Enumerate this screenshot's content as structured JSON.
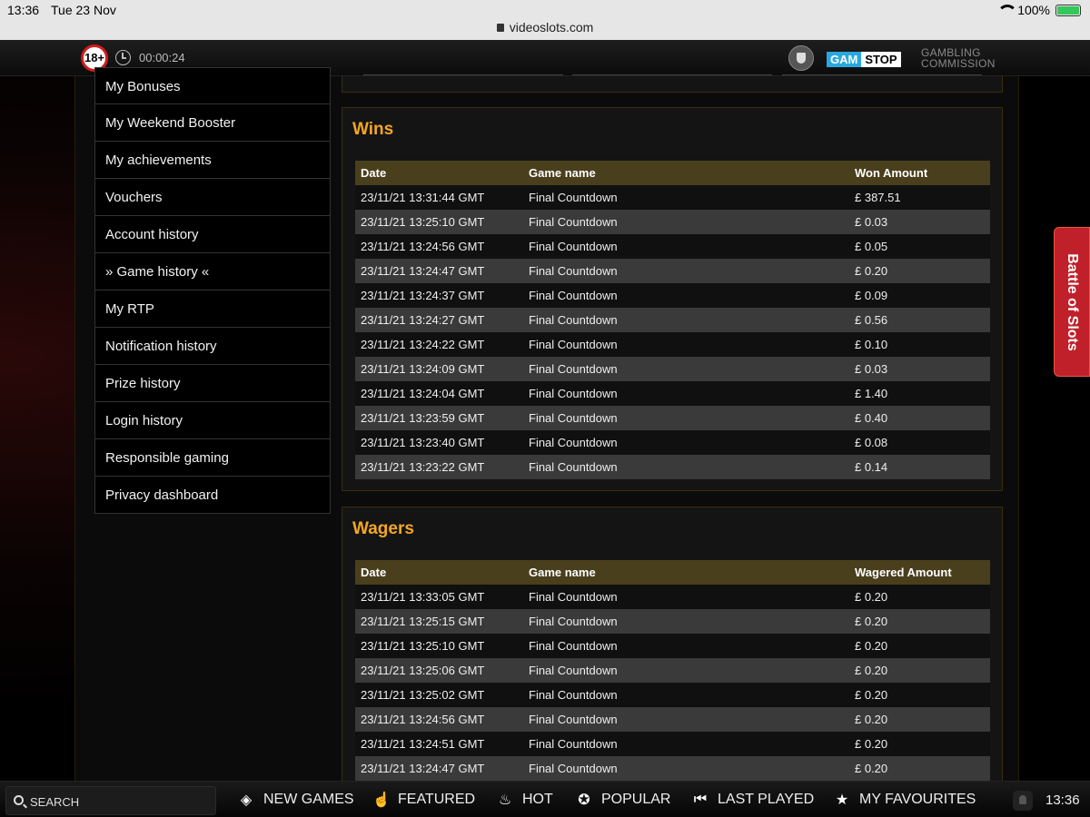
{
  "ios": {
    "time": "13:36",
    "date": "Tue 23 Nov",
    "url": "videoslots.com",
    "battery": "100%"
  },
  "topbar": {
    "age_badge": "18+",
    "session_time": "00:00:24",
    "gamstop_a": "GAM",
    "gamstop_b": "STOP",
    "gc_line1": "GAMBLING",
    "gc_line2": "COMMISSION"
  },
  "menu": [
    "My Bonuses",
    "My Weekend Booster",
    "My achievements",
    "Vouchers",
    "Account history",
    "» Game history «",
    "My RTP",
    "Notification history",
    "Prize history",
    "Login history",
    "Responsible gaming",
    "Privacy dashboard"
  ],
  "wins": {
    "title": "Wins",
    "headers": [
      "Date",
      "Game name",
      "Won Amount"
    ],
    "rows": [
      [
        "23/11/21 13:31:44 GMT",
        "Final Countdown",
        "£ 387.51"
      ],
      [
        "23/11/21 13:25:10 GMT",
        "Final Countdown",
        "£ 0.03"
      ],
      [
        "23/11/21 13:24:56 GMT",
        "Final Countdown",
        "£ 0.05"
      ],
      [
        "23/11/21 13:24:47 GMT",
        "Final Countdown",
        "£ 0.20"
      ],
      [
        "23/11/21 13:24:37 GMT",
        "Final Countdown",
        "£ 0.09"
      ],
      [
        "23/11/21 13:24:27 GMT",
        "Final Countdown",
        "£ 0.56"
      ],
      [
        "23/11/21 13:24:22 GMT",
        "Final Countdown",
        "£ 0.10"
      ],
      [
        "23/11/21 13:24:09 GMT",
        "Final Countdown",
        "£ 0.03"
      ],
      [
        "23/11/21 13:24:04 GMT",
        "Final Countdown",
        "£ 1.40"
      ],
      [
        "23/11/21 13:23:59 GMT",
        "Final Countdown",
        "£ 0.40"
      ],
      [
        "23/11/21 13:23:40 GMT",
        "Final Countdown",
        "£ 0.08"
      ],
      [
        "23/11/21 13:23:22 GMT",
        "Final Countdown",
        "£ 0.14"
      ]
    ]
  },
  "wagers": {
    "title": "Wagers",
    "headers": [
      "Date",
      "Game name",
      "Wagered Amount"
    ],
    "rows": [
      [
        "23/11/21 13:33:05 GMT",
        "Final Countdown",
        "£ 0.20"
      ],
      [
        "23/11/21 13:25:15 GMT",
        "Final Countdown",
        "£ 0.20"
      ],
      [
        "23/11/21 13:25:10 GMT",
        "Final Countdown",
        "£ 0.20"
      ],
      [
        "23/11/21 13:25:06 GMT",
        "Final Countdown",
        "£ 0.20"
      ],
      [
        "23/11/21 13:25:02 GMT",
        "Final Countdown",
        "£ 0.20"
      ],
      [
        "23/11/21 13:24:56 GMT",
        "Final Countdown",
        "£ 0.20"
      ],
      [
        "23/11/21 13:24:51 GMT",
        "Final Countdown",
        "£ 0.20"
      ],
      [
        "23/11/21 13:24:47 GMT",
        "Final Countdown",
        "£ 0.20"
      ]
    ]
  },
  "battle_tab": "Battle of Slots",
  "bottom_nav": {
    "search": "SEARCH",
    "items": [
      {
        "label": "NEW GAMES",
        "icon": "die-icon"
      },
      {
        "label": "FEATURED",
        "icon": "thumbs-up-icon"
      },
      {
        "label": "HOT",
        "icon": "flame-icon"
      },
      {
        "label": "POPULAR",
        "icon": "star-bubble-icon"
      },
      {
        "label": "LAST PLAYED",
        "icon": "rewind-icon"
      },
      {
        "label": "MY FAVOURITES",
        "icon": "star-icon"
      }
    ],
    "time": "13:36"
  }
}
